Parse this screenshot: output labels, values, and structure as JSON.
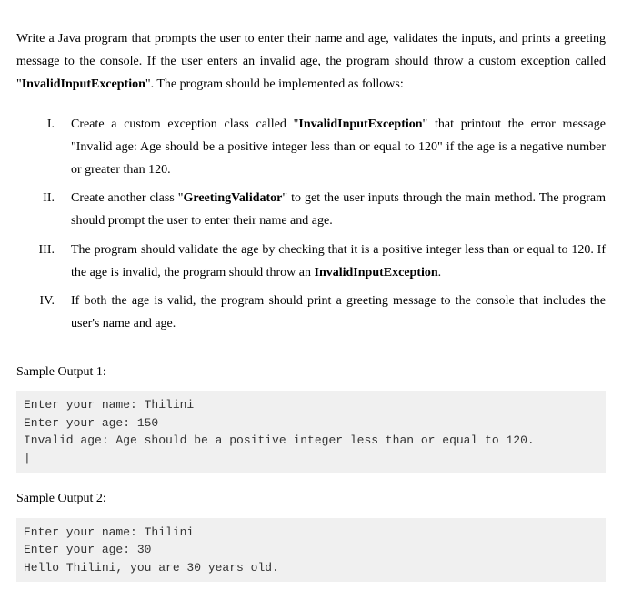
{
  "intro": {
    "part1": "Write a Java program that prompts the user to enter their name and age, validates the inputs, and prints a greeting message to the console. If the user enters an invalid age, the program should throw a custom exception called \"",
    "bold1": "InvalidInputException",
    "part2": "\". The program should be implemented as follows:"
  },
  "items": [
    {
      "marker": "I.",
      "pre": "Create a custom exception class called \"",
      "bold": "InvalidInputException",
      "post": "\" that printout the error message \"Invalid age: Age should be a positive integer less than or equal to 120\" if the age is a negative number or greater than 120."
    },
    {
      "marker": "II.",
      "pre": "Create another class \"",
      "bold": "GreetingValidator",
      "post": "\" to get the user inputs through the main method. The program should prompt the user to enter their name and age."
    },
    {
      "marker": "III.",
      "pre": "The program should validate the age by checking that it is a positive integer less than or equal to 120. If the age is invalid, the program should throw an ",
      "bold": "InvalidInputException",
      "post": "."
    },
    {
      "marker": "IV.",
      "pre": "If both the age is valid, the program should print a greeting message to the console that includes the user's name and age.",
      "bold": "",
      "post": ""
    }
  ],
  "sample1": {
    "label": "Sample Output 1:",
    "code": "Enter your name: Thilini\nEnter your age: 150\nInvalid age: Age should be a positive integer less than or equal to 120.\n|"
  },
  "sample2": {
    "label": "Sample Output 2:",
    "code": "Enter your name: Thilini\nEnter your age: 30\nHello Thilini, you are 30 years old."
  }
}
